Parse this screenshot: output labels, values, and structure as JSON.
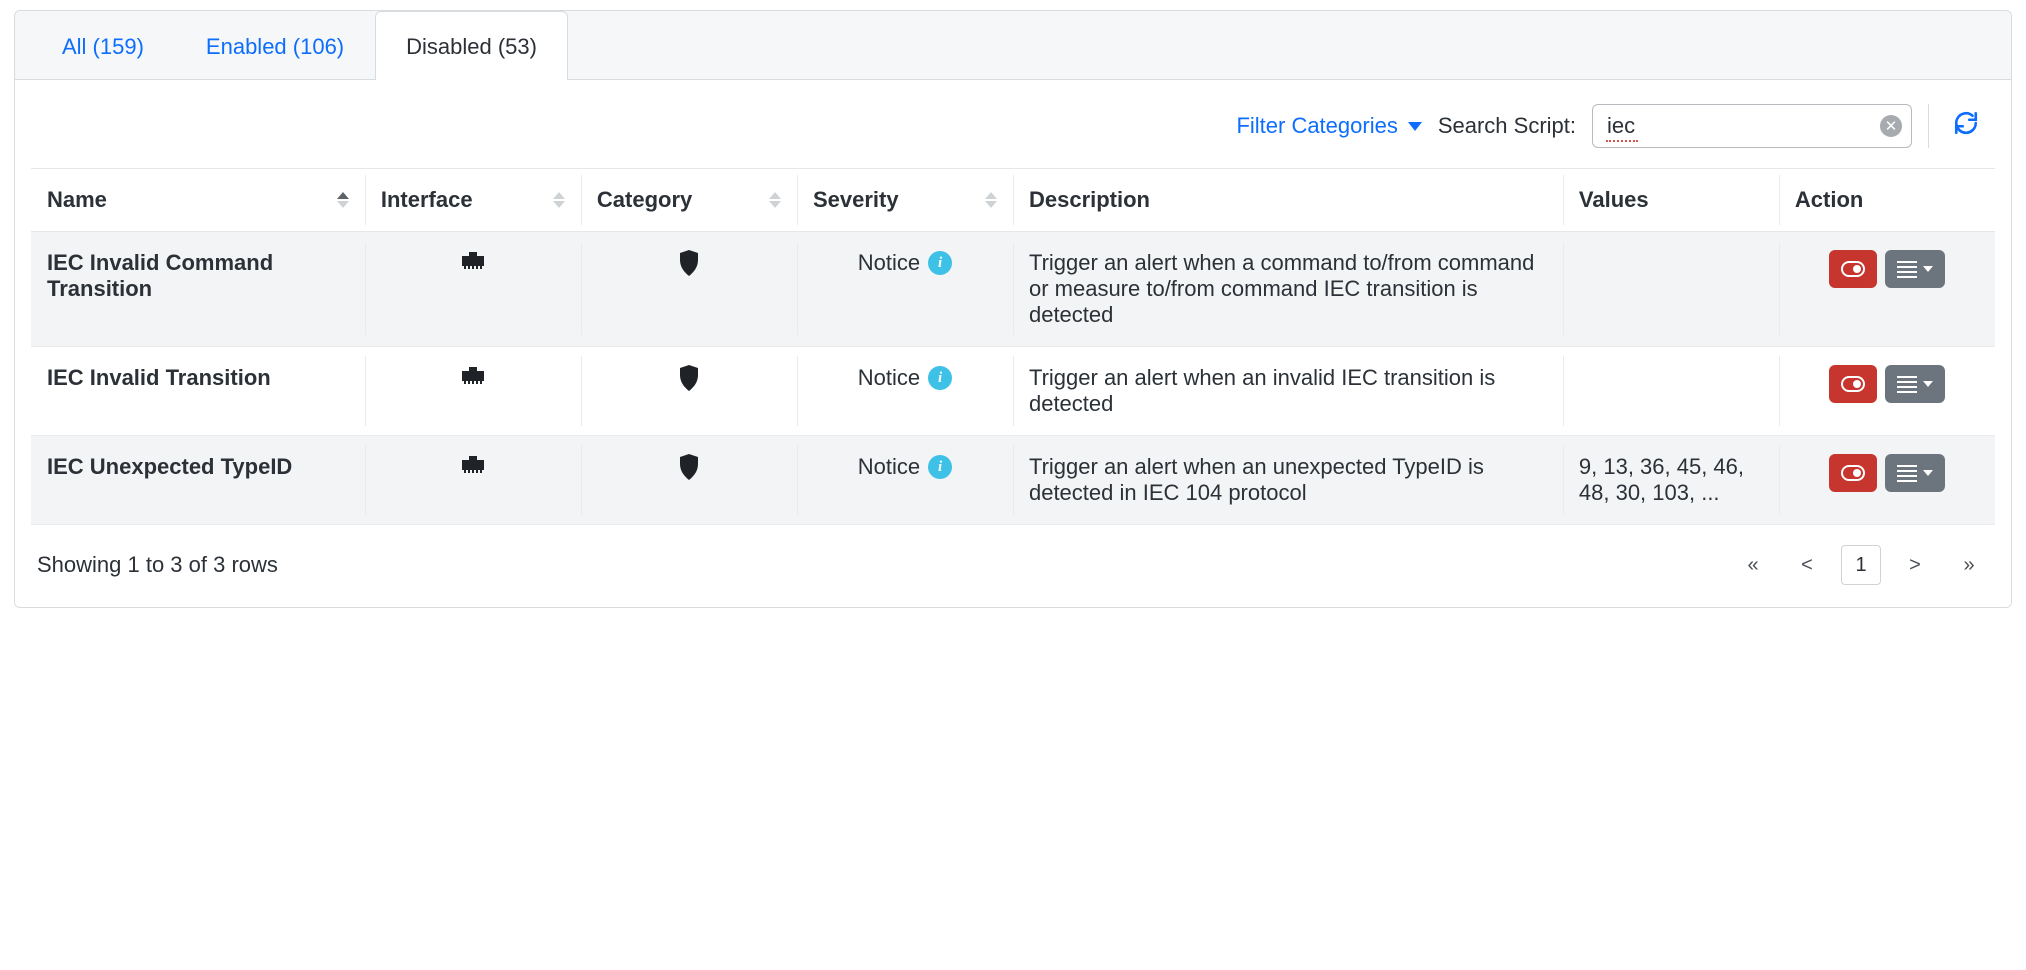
{
  "tabs": [
    {
      "label": "All (159)",
      "active": false
    },
    {
      "label": "Enabled (106)",
      "active": false
    },
    {
      "label": "Disabled (53)",
      "active": true
    }
  ],
  "toolbar": {
    "filter_label": "Filter Categories",
    "search_label": "Search Script:",
    "search_value": "iec"
  },
  "columns": {
    "name": "Name",
    "interface": "Interface",
    "category": "Category",
    "severity": "Severity",
    "description": "Description",
    "values": "Values",
    "action": "Action"
  },
  "rows": [
    {
      "name": "IEC Invalid Command Transition",
      "severity": "Notice",
      "description": "Trigger an alert when a command to/from command or measure to/from command IEC transition is detected",
      "values": ""
    },
    {
      "name": "IEC Invalid Transition",
      "severity": "Notice",
      "description": "Trigger an alert when an invalid IEC transition is detected",
      "values": ""
    },
    {
      "name": "IEC Unexpected TypeID",
      "severity": "Notice",
      "description": "Trigger an alert when an unexpected TypeID is detected in IEC 104 protocol",
      "values": "9, 13, 36, 45, 46, 48, 30, 103, ..."
    }
  ],
  "footer": {
    "status": "Showing 1 to 3 of 3 rows",
    "page": "1"
  }
}
